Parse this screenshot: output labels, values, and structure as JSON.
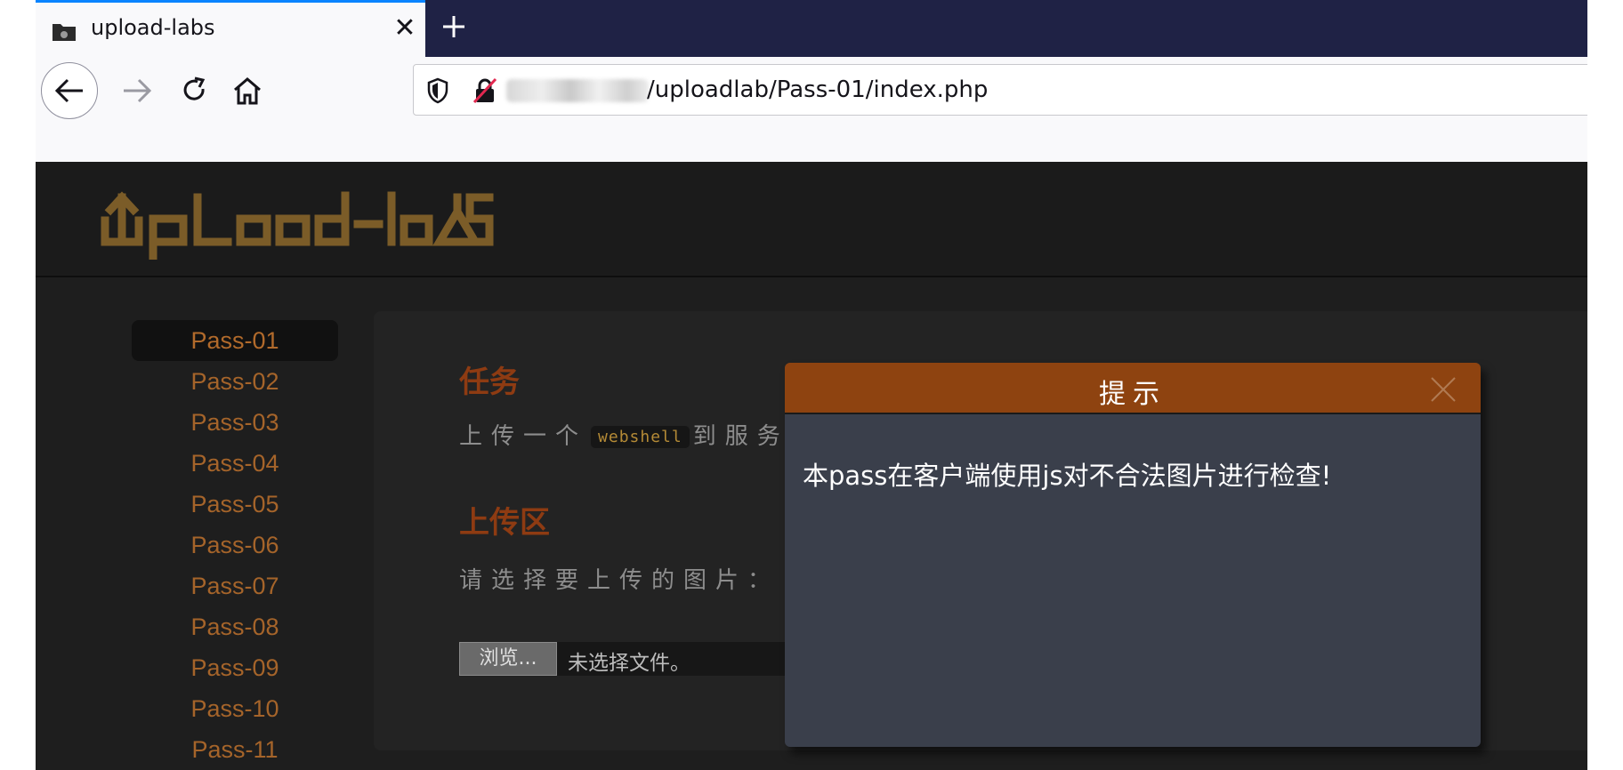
{
  "browser": {
    "tab_title": "upload-labs",
    "tab_close": "✕",
    "new_tab": "+",
    "url": "/uploadlab/Pass-01/index.php"
  },
  "site": {
    "logo_text": "UpLoad-labs",
    "logo_color": "#7b5c28"
  },
  "sidebar": {
    "items": [
      {
        "label": "Pass-01"
      },
      {
        "label": "Pass-02"
      },
      {
        "label": "Pass-03"
      },
      {
        "label": "Pass-04"
      },
      {
        "label": "Pass-05"
      },
      {
        "label": "Pass-06"
      },
      {
        "label": "Pass-07"
      },
      {
        "label": "Pass-08"
      },
      {
        "label": "Pass-09"
      },
      {
        "label": "Pass-10"
      },
      {
        "label": "Pass-11"
      }
    ],
    "active": "Pass-01"
  },
  "panel": {
    "task_heading": "任务",
    "task_text_before": "上传一个",
    "task_code": "webshell",
    "task_text_after": "到服务",
    "upload_heading": "上传区",
    "upload_prompt": "请选择要上传的图片：",
    "browse_label": "浏览...",
    "file_status": "未选择文件。"
  },
  "modal": {
    "title": "提示",
    "message": "本pass在客户端使用js对不合法图片进行检查!"
  },
  "colors": {
    "accent_orange": "#8e4310",
    "sidebar_link": "#a5642a",
    "tab_highlight": "#0a84ff"
  }
}
